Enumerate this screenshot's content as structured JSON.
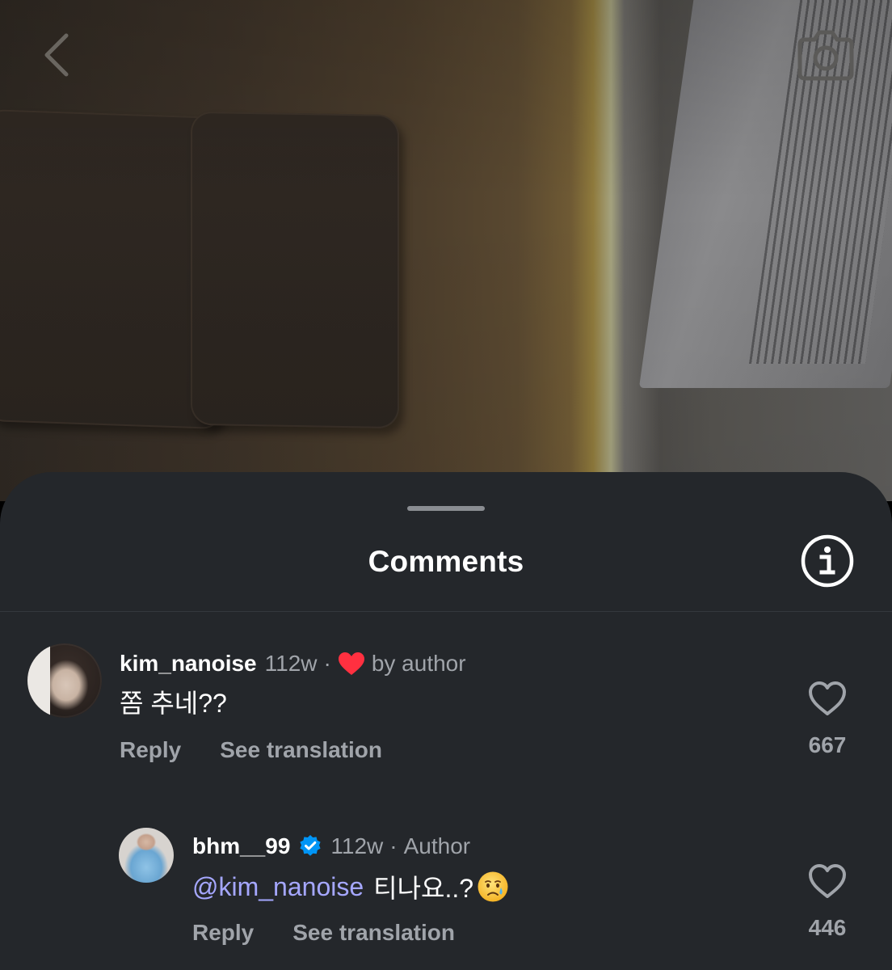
{
  "photo": {
    "back_icon": "chevron-left-icon",
    "camera_icon": "camera-icon"
  },
  "sheet": {
    "title": "Comments",
    "info_icon": "info-icon"
  },
  "comments": [
    {
      "username": "kim_nanoise",
      "time": "112w",
      "separator": "·",
      "liked_by_author_label": "by author",
      "text": "쫌 추네??",
      "reply_label": "Reply",
      "translate_label": "See translation",
      "like_count": "667"
    },
    {
      "username": "bhm__99",
      "verified": true,
      "time": "112w",
      "separator": "·",
      "author_label": "Author",
      "mention": "@kim_nanoise",
      "text": "티나요..?",
      "emoji": "crying-face",
      "reply_label": "Reply",
      "translate_label": "See translation",
      "like_count": "446"
    }
  ],
  "colors": {
    "sheet_bg": "#24272b",
    "muted_text": "#a0a4aa",
    "mention": "#a5a7ff",
    "heart_red": "#ff3040",
    "verified_blue": "#0095f6"
  }
}
